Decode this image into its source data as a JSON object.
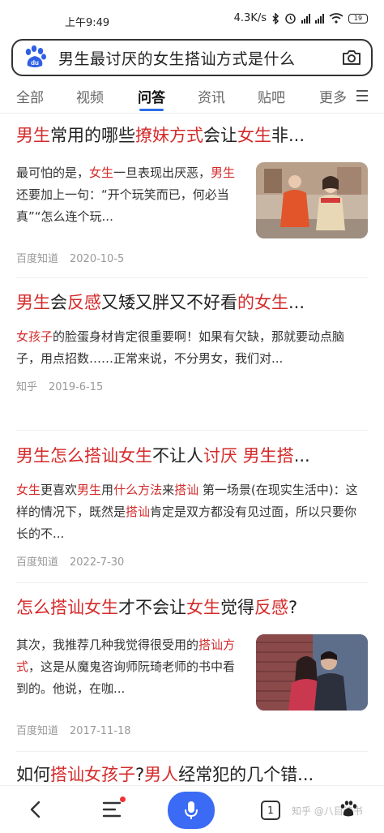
{
  "status_bar": {
    "time": "上午9:49",
    "network_speed": "4.3K/s",
    "battery": "19",
    "icons": [
      "bluetooth-icon",
      "alarm-icon",
      "signal-hd-icon",
      "signal-hd-icon",
      "wifi-icon",
      "battery-icon"
    ]
  },
  "search": {
    "query": "男生最讨厌的女生搭讪方式是什么",
    "logo": "baidu-paw-logo",
    "camera_icon": "camera-icon"
  },
  "tabs": [
    {
      "label": "全部"
    },
    {
      "label": "视频"
    },
    {
      "label": "问答",
      "active": true
    },
    {
      "label": "资讯"
    },
    {
      "label": "贴吧"
    },
    {
      "label": "更多"
    }
  ],
  "accent_colors": {
    "highlight": "#d42a2a",
    "tab_underline": "#2b6de5",
    "voice_button": "#3b6bf5"
  },
  "results": [
    {
      "title_parts": [
        {
          "text": "男生",
          "hl": true
        },
        {
          "text": "常用的哪些",
          "hl": false
        },
        {
          "text": "撩妹方式",
          "hl": true
        },
        {
          "text": "会让",
          "hl": false
        },
        {
          "text": "女生",
          "hl": true
        },
        {
          "text": "非...",
          "hl": false
        }
      ],
      "snippet_parts": [
        {
          "text": "最可怕的是，",
          "hl": false
        },
        {
          "text": "女生",
          "hl": true
        },
        {
          "text": "一旦表现出厌恶，",
          "hl": false
        },
        {
          "text": "男生",
          "hl": true
        },
        {
          "text": "还要加上一句：“开个玩笑而已，何必当真”“怎么连个玩...",
          "hl": false
        }
      ],
      "source": "百度知道",
      "date": "2020-10-5",
      "has_thumb": true
    },
    {
      "title_parts": [
        {
          "text": "男生",
          "hl": true
        },
        {
          "text": "会",
          "hl": false
        },
        {
          "text": "反感",
          "hl": true
        },
        {
          "text": "又矮又胖又不好看",
          "hl": false
        },
        {
          "text": "的女生",
          "hl": true
        },
        {
          "text": "...",
          "hl": false
        }
      ],
      "snippet_parts": [
        {
          "text": "女孩子",
          "hl": true
        },
        {
          "text": "的脸蛋身材肯定很重要啊！如果有欠缺，那就要动点脑子，用点招数……正常来说，不分男女，我们对...",
          "hl": false
        }
      ],
      "source": "知乎",
      "date": "2019-6-15",
      "has_thumb": false
    },
    {
      "title_parts": [
        {
          "text": "男生怎么搭讪女生",
          "hl": true
        },
        {
          "text": "不让人",
          "hl": false
        },
        {
          "text": "讨厌 男生搭",
          "hl": true
        },
        {
          "text": "...",
          "hl": false
        }
      ],
      "snippet_parts": [
        {
          "text": "女生",
          "hl": true
        },
        {
          "text": "更喜欢",
          "hl": false
        },
        {
          "text": "男生",
          "hl": true
        },
        {
          "text": "用",
          "hl": false
        },
        {
          "text": "什么方法",
          "hl": true
        },
        {
          "text": "来",
          "hl": false
        },
        {
          "text": "搭讪",
          "hl": true
        },
        {
          "text": " 第一场景(在现实生活中)：这样的情况下，既然是",
          "hl": false
        },
        {
          "text": "搭讪",
          "hl": true
        },
        {
          "text": "肯定是双方都没有见过面，所以只要你长的不...",
          "hl": false
        }
      ],
      "source": "百度知道",
      "date": "2022-7-30",
      "has_thumb": false
    },
    {
      "title_parts": [
        {
          "text": "怎么搭讪女生",
          "hl": true
        },
        {
          "text": "才不会让",
          "hl": false
        },
        {
          "text": "女生",
          "hl": true
        },
        {
          "text": "觉得",
          "hl": false
        },
        {
          "text": "反感",
          "hl": true
        },
        {
          "text": "?",
          "hl": false
        }
      ],
      "snippet_parts": [
        {
          "text": "其次，我推荐几种我觉得很受用的",
          "hl": false
        },
        {
          "text": "搭讪方式",
          "hl": true
        },
        {
          "text": "，这是从魔鬼咨询师阮琦老师的书中看到的。他说，在咖...",
          "hl": false
        }
      ],
      "source": "百度知道",
      "date": "2017-11-18",
      "has_thumb": true
    },
    {
      "title_parts": [
        {
          "text": "如何",
          "hl": false
        },
        {
          "text": "搭讪女孩子",
          "hl": true
        },
        {
          "text": "?",
          "hl": false
        },
        {
          "text": "男人",
          "hl": true
        },
        {
          "text": "经常犯的几个错...",
          "hl": false
        }
      ]
    }
  ],
  "bottom_nav": {
    "tab_count": "1",
    "watermark": "知乎 @八目读书"
  }
}
